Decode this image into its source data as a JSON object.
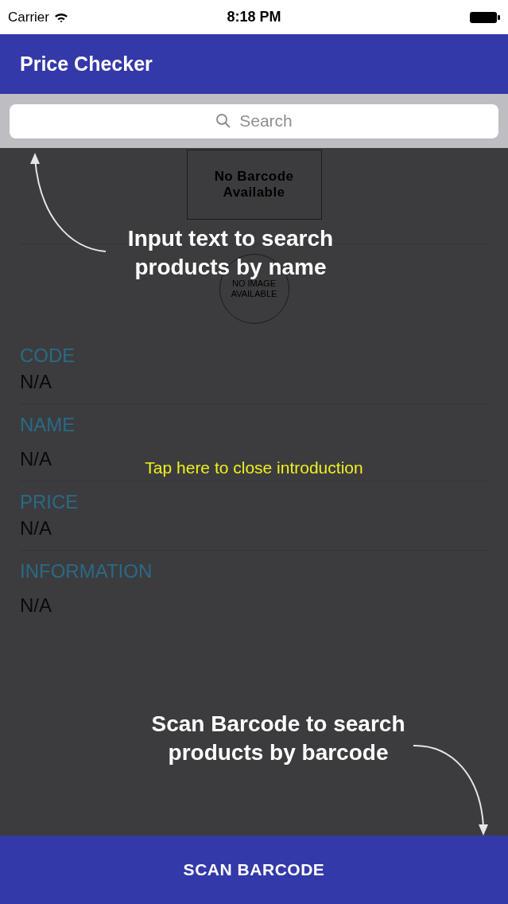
{
  "status_bar": {
    "carrier": "Carrier",
    "time": "8:18 PM"
  },
  "header": {
    "title": "Price Checker"
  },
  "search": {
    "placeholder": "Search"
  },
  "barcode": {
    "text": "No Barcode Available"
  },
  "product_image": {
    "text": "NO IMAGE AVAILABLE"
  },
  "fields": [
    {
      "label": "CODE",
      "value": "N/A"
    },
    {
      "label": "NAME",
      "value": "N/A"
    },
    {
      "label": "PRICE",
      "value": "N/A"
    },
    {
      "label": "INFORMATION",
      "value": "N/A"
    }
  ],
  "intro": {
    "search_hint": "Input text to search products by name",
    "close_hint": "Tap here to close introduction",
    "scan_hint": "Scan Barcode to search products by barcode"
  },
  "scan_button": {
    "label": "SCAN BARCODE"
  }
}
